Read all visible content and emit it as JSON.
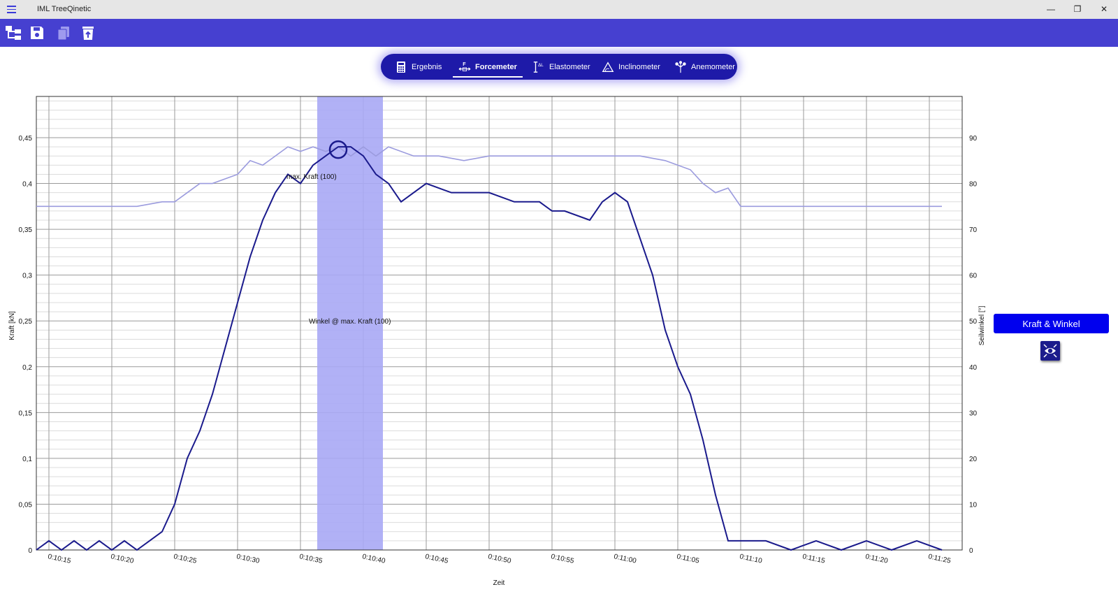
{
  "window": {
    "title": "IML TreeQinetic",
    "minimize_glyph": "—",
    "maximize_glyph": "❐",
    "close_glyph": "✕"
  },
  "toolbar": {
    "icons": [
      "tree-structure-icon",
      "save-icon",
      "copy-icon",
      "delete-icon"
    ]
  },
  "tabs": [
    {
      "label": "Ergebnis",
      "icon": "calculator-icon",
      "active": false
    },
    {
      "label": "Forcemeter",
      "icon": "force-icon",
      "active": true
    },
    {
      "label": "Elastometer",
      "icon": "elongation-icon",
      "active": false
    },
    {
      "label": "Inclinometer",
      "icon": "inclination-icon",
      "active": false
    },
    {
      "label": "Anemometer",
      "icon": "wind-icon",
      "active": false
    }
  ],
  "side_panel": {
    "chart_toggle_label": "Kraft & Winkel",
    "reset_zoom_icon": "zoom-reset-icon"
  },
  "colors": {
    "accent": "#4640d0",
    "force_line": "#1a1a8c",
    "angle_line": "#9b9bde",
    "highlight": "#a8a8f5",
    "button": "#0000ee"
  },
  "chart_data": {
    "type": "line",
    "xlabel": "Zeit",
    "ylabel": "Kraft [kN]",
    "y2label": "Seilwinkel [°]",
    "ylim": [
      0,
      0.5
    ],
    "y2lim": [
      0,
      100
    ],
    "yticks": [
      "0",
      "0,05",
      "0,1",
      "0,15",
      "0,2",
      "0,25",
      "0,3",
      "0,35",
      "0,4",
      "0,45"
    ],
    "y2ticks": [
      "0",
      "10",
      "20",
      "30",
      "40",
      "50",
      "60",
      "70",
      "80",
      "90"
    ],
    "xticks": [
      "0:10:15",
      "0:10:20",
      "0:10:25",
      "0:10:30",
      "0:10:35",
      "0:10:40",
      "0:10:45",
      "0:10:50",
      "0:10:55",
      "0:11:00",
      "0:11:05",
      "0:11:10",
      "0:11:15",
      "0:11:20",
      "0:11:25"
    ],
    "grid": true,
    "annotations": {
      "max_force": "max. Kraft (100)",
      "angle_at_max": "Winkel @ max. Kraft (100)"
    },
    "highlight_range": [
      "0:10:36",
      "0:10:41"
    ],
    "series": [
      {
        "axis": "left",
        "t": [
          "0:10:14",
          "0:10:15",
          "0:10:16",
          "0:10:17",
          "0:10:18",
          "0:10:19",
          "0:10:20",
          "0:10:21",
          "0:10:22",
          "0:10:23",
          "0:10:24",
          "0:10:25",
          "0:10:26",
          "0:10:27",
          "0:10:28",
          "0:10:29",
          "0:10:30",
          "0:10:31",
          "0:10:32",
          "0:10:33",
          "0:10:34",
          "0:10:35",
          "0:10:36",
          "0:10:37",
          "0:10:38",
          "0:10:39",
          "0:10:40",
          "0:10:41",
          "0:10:42",
          "0:10:43",
          "0:10:45",
          "0:10:47",
          "0:10:49",
          "0:10:50",
          "0:10:52",
          "0:10:54",
          "0:10:55",
          "0:10:56",
          "0:10:58",
          "0:10:59",
          "0:11:00",
          "0:11:01",
          "0:11:02",
          "0:11:03",
          "0:11:04",
          "0:11:05",
          "0:11:06",
          "0:11:07",
          "0:11:08",
          "0:11:09",
          "0:11:10",
          "0:11:12",
          "0:11:14",
          "0:11:16",
          "0:11:18",
          "0:11:20",
          "0:11:22",
          "0:11:24",
          "0:11:26"
        ],
        "values": [
          0,
          0.01,
          0,
          0.01,
          0,
          0.01,
          0,
          0.01,
          0,
          0.01,
          0.02,
          0.05,
          0.1,
          0.13,
          0.17,
          0.22,
          0.27,
          0.32,
          0.36,
          0.39,
          0.41,
          0.4,
          0.42,
          0.43,
          0.44,
          0.44,
          0.43,
          0.41,
          0.4,
          0.38,
          0.4,
          0.39,
          0.39,
          0.39,
          0.38,
          0.38,
          0.37,
          0.37,
          0.36,
          0.38,
          0.39,
          0.38,
          0.34,
          0.3,
          0.24,
          0.2,
          0.17,
          0.12,
          0.06,
          0.01,
          0.01,
          0.01,
          0,
          0.01,
          0,
          0.01,
          0,
          0.01,
          0
        ]
      },
      {
        "axis": "right",
        "t": [
          "0:10:14",
          "0:10:16",
          "0:10:18",
          "0:10:20",
          "0:10:22",
          "0:10:24",
          "0:10:25",
          "0:10:26",
          "0:10:27",
          "0:10:28",
          "0:10:29",
          "0:10:30",
          "0:10:31",
          "0:10:32",
          "0:10:33",
          "0:10:34",
          "0:10:35",
          "0:10:36",
          "0:10:37",
          "0:10:38",
          "0:10:39",
          "0:10:40",
          "0:10:41",
          "0:10:42",
          "0:10:44",
          "0:10:46",
          "0:10:48",
          "0:10:50",
          "0:10:52",
          "0:10:54",
          "0:10:56",
          "0:10:58",
          "0:11:00",
          "0:11:02",
          "0:11:04",
          "0:11:06",
          "0:11:07",
          "0:11:08",
          "0:11:09",
          "0:11:10",
          "0:11:12",
          "0:11:14",
          "0:11:16",
          "0:11:18",
          "0:11:20",
          "0:11:22",
          "0:11:24",
          "0:11:26"
        ],
        "values": [
          75,
          75,
          75,
          75,
          75,
          76,
          76,
          78,
          80,
          80,
          81,
          82,
          85,
          84,
          86,
          88,
          87,
          88,
          87,
          88,
          86,
          88,
          86,
          88,
          86,
          86,
          85,
          86,
          86,
          86,
          86,
          86,
          86,
          86,
          85,
          83,
          80,
          78,
          79,
          75,
          75,
          75,
          75,
          75,
          75,
          75,
          75,
          75
        ]
      }
    ]
  }
}
